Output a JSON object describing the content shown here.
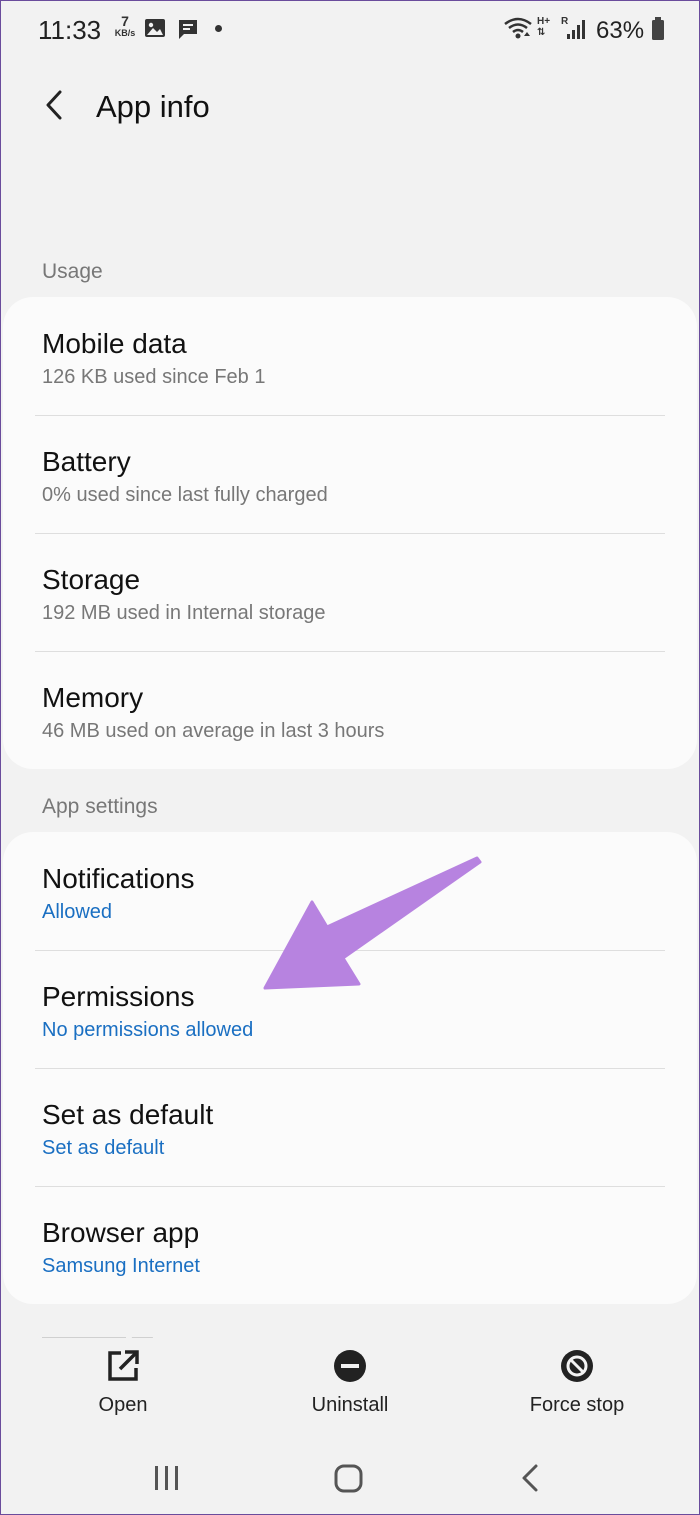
{
  "status_bar": {
    "time": "11:33",
    "speed_value": "7",
    "speed_unit": "KB/s",
    "battery_percent": "63%",
    "network_label": "H+",
    "roaming_label": "R"
  },
  "header": {
    "title": "App info"
  },
  "usage": {
    "label": "Usage",
    "items": [
      {
        "title": "Mobile data",
        "subtitle": "126 KB used since Feb 1"
      },
      {
        "title": "Battery",
        "subtitle": "0% used since last fully charged"
      },
      {
        "title": "Storage",
        "subtitle": "192 MB used in Internal storage"
      },
      {
        "title": "Memory",
        "subtitle": "46 MB used on average in last 3 hours"
      }
    ]
  },
  "app_settings": {
    "label": "App settings",
    "items": [
      {
        "title": "Notifications",
        "subtitle": "Allowed"
      },
      {
        "title": "Permissions",
        "subtitle": "No permissions allowed"
      },
      {
        "title": "Set as default",
        "subtitle": "Set as default"
      },
      {
        "title": "Browser app",
        "subtitle": "Samsung Internet"
      }
    ]
  },
  "actions": {
    "open": "Open",
    "uninstall": "Uninstall",
    "force_stop": "Force stop"
  },
  "colors": {
    "accent_link": "#1a6fc2",
    "annotation_arrow": "#b783e0",
    "background": "#f2f2f2",
    "card": "#fbfbfb"
  }
}
